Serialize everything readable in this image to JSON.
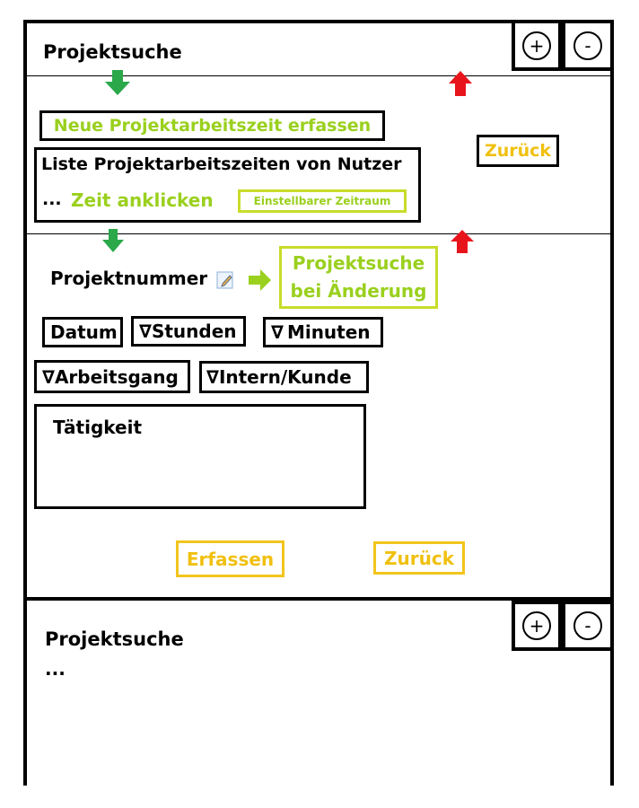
{
  "panel1": {
    "title": "Projektsuche",
    "plus": "+",
    "minus": "-",
    "new_entry": "Neue Projektarbeitszeit erfassen",
    "back": "Zurück",
    "list_title": "Liste Projektarbeitszeiten von Nutzer",
    "ellipsis": "...",
    "click_time": "Zeit anklicken",
    "range": "Einstellbarer Zeitraum"
  },
  "panel2": {
    "project_number": "Projektnummer",
    "search_line1": "Projektsuche",
    "search_line2": "bei Änderung",
    "date": "Datum",
    "hours": "Stunden",
    "minutes": "Minuten",
    "work_step": "Arbeitsgang",
    "intern_customer": "Intern/Kunde",
    "activity": "Tätigkeit",
    "submit": "Erfassen",
    "back": "Zurück",
    "dropdown_glyph": "∇"
  },
  "panel3": {
    "title": "Projektsuche",
    "ellipsis": "...",
    "plus": "+",
    "minus": "-"
  },
  "colors": {
    "green_arrow": "#2aa84a",
    "red_arrow": "#e8141c",
    "lime_text": "#9ad01e",
    "yellow_text": "#f0c010"
  }
}
